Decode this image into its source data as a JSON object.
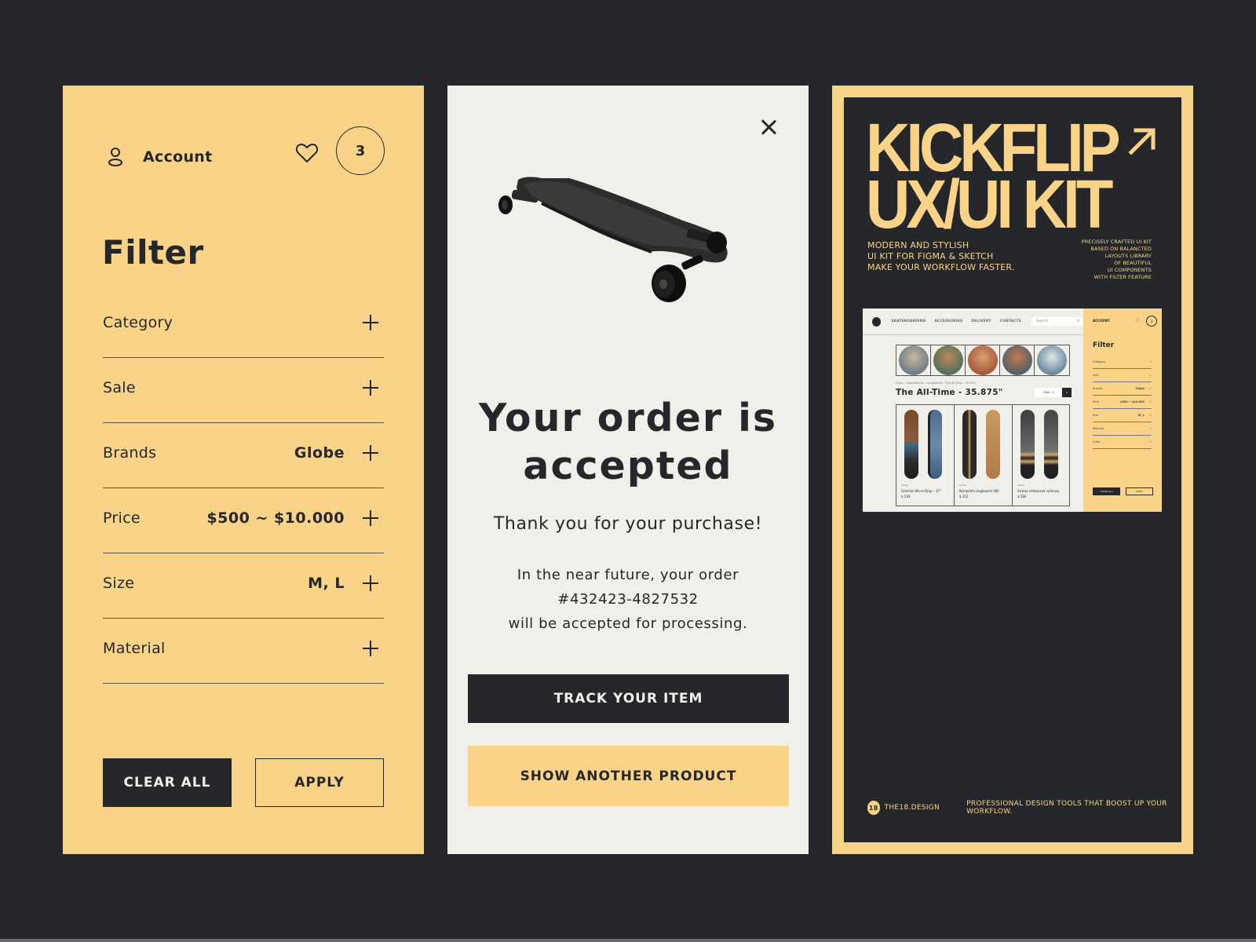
{
  "colors": {
    "background": "#25272a",
    "accent_yellow": "#f9d488",
    "paper": "#f1efea",
    "ink": "#25272a"
  },
  "filter_panel": {
    "account_label": "Account",
    "account_icon": "user-icon",
    "wishlist_icon": "heart-icon",
    "cart_count": "3",
    "title": "Filter",
    "rows": [
      {
        "label": "Category",
        "value": ""
      },
      {
        "label": "Sale",
        "value": ""
      },
      {
        "label": "Brands",
        "value": "Globe"
      },
      {
        "label": "Price",
        "value": "$500 ~ $10.000"
      },
      {
        "label": "Size",
        "value": "M, L"
      },
      {
        "label": "Material",
        "value": ""
      }
    ],
    "expand_icon": "plus-icon",
    "clear_label": "CLEAR ALL",
    "apply_label": "APPLY"
  },
  "order_panel": {
    "close_icon": "close-icon",
    "product_image": "longboard-image",
    "title_line1": "Your order is",
    "title_line2": "accepted",
    "thanks": "Thank you for your purchase!",
    "note_line1": "In the near future, your order",
    "order_number": "#432423-4827532",
    "note_line3": "will be accepted for processing.",
    "track_label": "TRACK YOUR ITEM",
    "another_label": "SHOW ANOTHER PRODUCT"
  },
  "kit_panel": {
    "title_line1": "KICKFLIP",
    "title_line2": "UX/UI KIT",
    "arrow_icon": "arrow-up-right-icon",
    "desc_lines": [
      "MODERN AND STYLISH",
      "UI KIT FOR FIGMA & SKETCH",
      "MAKE YOUR WORKFLOW FASTER."
    ],
    "side_lines": [
      "PRECISELY CRAFTED UI KIT",
      "BASED ON BALANCTED",
      "LAYOUTS LIBRARY",
      "OF BEAUTIFUL",
      "UI COMPONENTS",
      "WITH FILTER FEATURE"
    ],
    "footer_logo": "18",
    "footer_brand": "THE18.DESIGN",
    "footer_tagline": "PROFESSIONAL DESIGN TOOLS THAT BOOST UP YOUR WORKFLOW.",
    "preview": {
      "nav_links": [
        "SKATEBOARDING",
        "ACCESSORIES",
        "DELIVERY",
        "CONTACTS"
      ],
      "search_placeholder": "Search",
      "breadcrumb": "Home › Skateboards › Longboards › The All-Time – 35.875\"",
      "heading": "The All-Time - 35.875\"",
      "filter_button": "Filter: 3",
      "products": [
        {
          "brand": "Globe",
          "name": "Gemlion Micro-Drop - 37\"",
          "price": "$ 239"
        },
        {
          "brand": "Globe",
          "name": "Komplett Longboards NEI",
          "price": "$ 212"
        },
        {
          "brand": "Globe",
          "name": "Arrows embossed suitcase",
          "price": "$ 284"
        }
      ],
      "side": {
        "account": "ACCOUNT",
        "cart_count": "3",
        "title": "Filter",
        "rows": [
          {
            "label": "Category",
            "value": ""
          },
          {
            "label": "Sale",
            "value": ""
          },
          {
            "label": "Brands",
            "value": "Globe"
          },
          {
            "label": "Price",
            "value": "$500 ~ $10.000"
          },
          {
            "label": "Size",
            "value": "M, L"
          },
          {
            "label": "Material",
            "value": ""
          },
          {
            "label": "Color",
            "value": ""
          }
        ],
        "clear": "CLEAR ALL",
        "apply": "APPLY"
      }
    }
  }
}
